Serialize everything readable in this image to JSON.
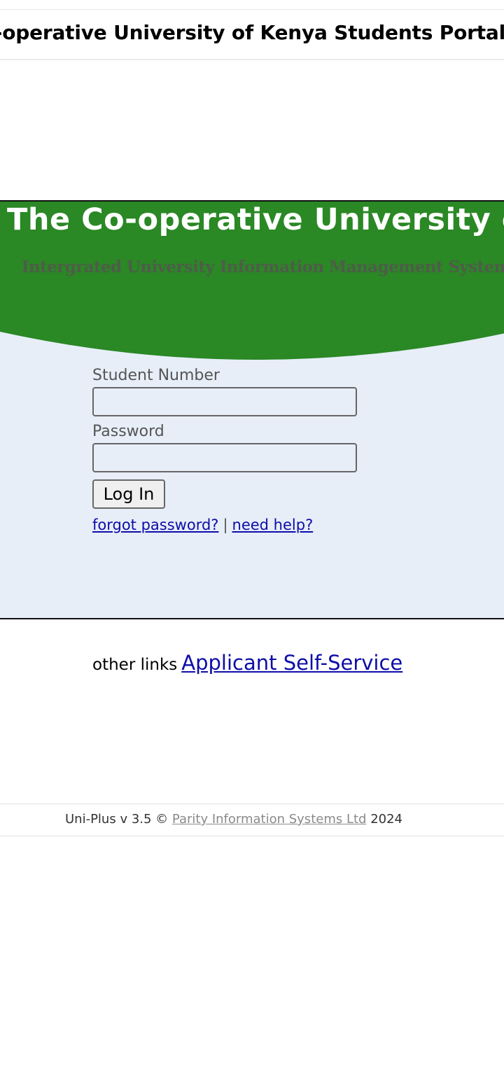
{
  "header": {
    "title": "The Co-operative University of Kenya Students Portal"
  },
  "banner": {
    "title": "The Co-operative University of Kenya",
    "subtitle": "Intergrated University Information Management System",
    "green": "#2a8825",
    "panel_bg": "#e7eef8"
  },
  "login_form": {
    "student_number_label": "Student Number",
    "student_number_value": "",
    "password_label": "Password",
    "password_value": "",
    "login_button": "Log In",
    "forgot_password": "forgot password?",
    "separator": "|",
    "need_help": "need help?"
  },
  "other_links": {
    "prefix": "other links",
    "applicant_self_service": "Applicant Self-Service"
  },
  "footer": {
    "prefix": "Uni-Plus v 3.5 ©",
    "company": "Parity Information Systems Ltd",
    "year": "2024"
  },
  "colors": {
    "link": "#0d0da8",
    "footer_link": "#8a8a8a"
  }
}
